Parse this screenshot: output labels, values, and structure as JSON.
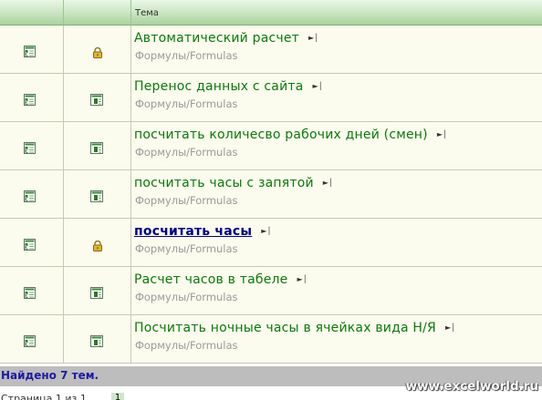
{
  "header": {
    "title": "Тема"
  },
  "rows": [
    {
      "title": "Автоматический расчет",
      "category": "Формулы/Formulas",
      "status_icon": "lock-icon"
    },
    {
      "title": "Перенос данных с сайта",
      "category": "Формулы/Formulas",
      "status_icon": "topic-icon"
    },
    {
      "title": "посчитать количесво рабочих дней (смен)",
      "category": "Формулы/Formulas",
      "status_icon": "topic-icon"
    },
    {
      "title": "посчитать часы с запятой",
      "category": "Формулы/Formulas",
      "status_icon": "topic-icon"
    },
    {
      "title": "посчитать часы",
      "category": "Формулы/Formulas",
      "status_icon": "lock-icon"
    },
    {
      "title": "Расчет часов в табеле",
      "category": "Формулы/Formulas",
      "status_icon": "topic-icon"
    },
    {
      "title": "Посчитать ночные часы в ячейках вида Н/Я",
      "category": "Формулы/Formulas",
      "status_icon": "topic-icon"
    }
  ],
  "footer": {
    "found": "Найдено 7 тем.",
    "watermark": "www.excelworld.ru"
  },
  "pager": {
    "label": "Страница 1 из 1",
    "current": "1"
  },
  "colors": {
    "topic": "#0a7a0a",
    "link": "#00008b",
    "header": "#a8d49c"
  }
}
